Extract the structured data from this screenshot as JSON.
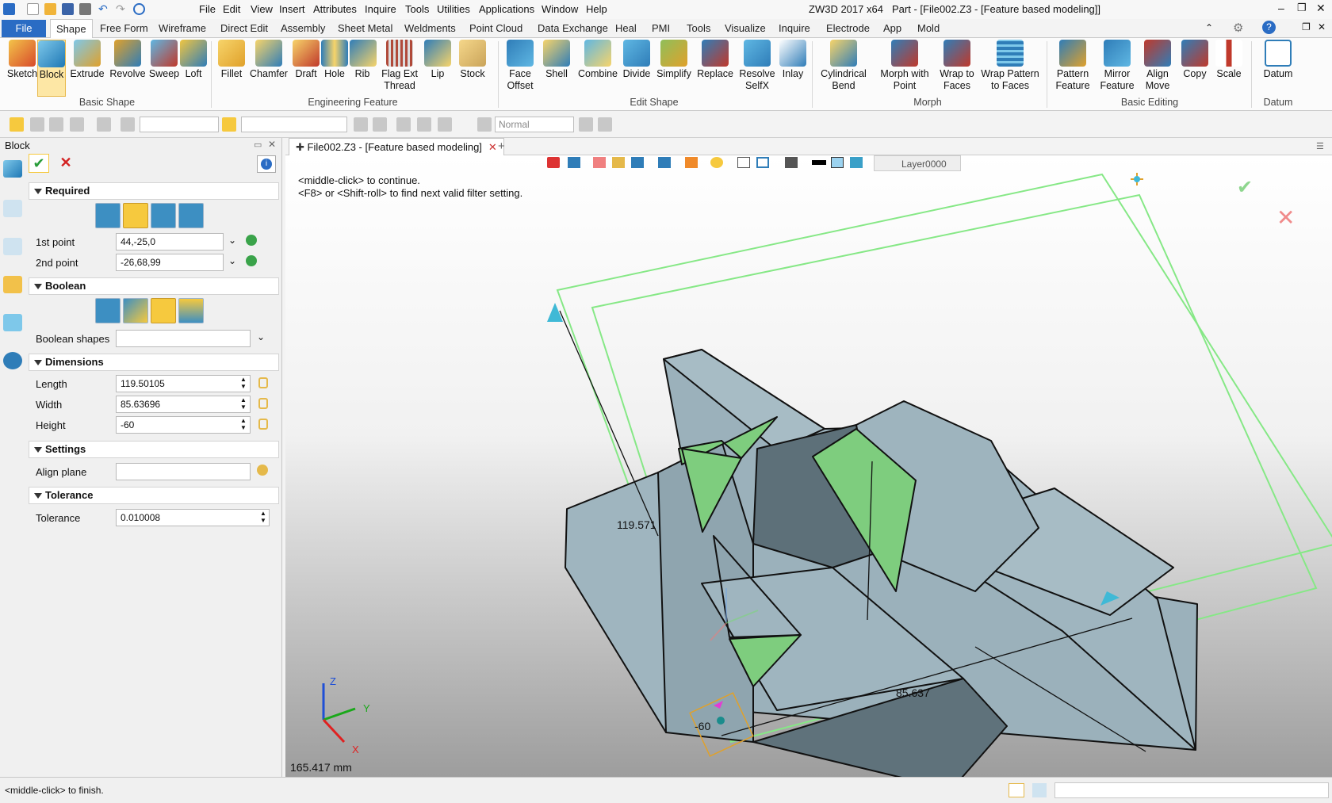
{
  "titlebar": {
    "menus": [
      "File",
      "Edit",
      "View",
      "Insert",
      "Attributes",
      "Inquire",
      "Tools",
      "Utilities",
      "Applications",
      "Window",
      "Help"
    ],
    "app_title": "ZW3D 2017  x64",
    "doc_title": "Part - [File002.Z3 - [Feature based modeling]]"
  },
  "ribbon_tabs": [
    "File",
    "Shape",
    "Free Form",
    "Wireframe",
    "Direct Edit",
    "Assembly",
    "Sheet Metal",
    "Weldments",
    "Point Cloud",
    "Data Exchange",
    "Heal",
    "PMI",
    "Tools",
    "Visualize",
    "Inquire",
    "Electrode",
    "App",
    "Mold"
  ],
  "ribbon": {
    "basic_shape": {
      "label": "Basic Shape",
      "buttons": [
        "Sketch",
        "Block",
        "Extrude",
        "Revolve",
        "Sweep",
        "Loft"
      ]
    },
    "engineering_feature": {
      "label": "Engineering Feature",
      "buttons": [
        "Fillet",
        "Chamfer",
        "Draft",
        "Hole",
        "Rib",
        "Flag Ext Thread",
        "Lip",
        "Stock"
      ]
    },
    "edit_shape": {
      "label": "Edit Shape",
      "buttons": [
        "Face Offset",
        "Shell",
        "Combine",
        "Divide",
        "Simplify",
        "Replace",
        "Resolve SelfX",
        "Inlay"
      ]
    },
    "morph": {
      "label": "Morph",
      "buttons": [
        "Cylindrical Bend",
        "Morph with Point",
        "Wrap to Faces",
        "Wrap Pattern to Faces"
      ]
    },
    "basic_editing": {
      "label": "Basic Editing",
      "buttons": [
        "Pattern Feature",
        "Mirror Feature",
        "Align Move",
        "Copy",
        "Scale"
      ]
    },
    "datum": {
      "label": "Datum",
      "buttons": [
        "Datum"
      ]
    }
  },
  "toolbar2": {
    "display_mode": "Normal"
  },
  "panel": {
    "title": "Block",
    "sections": {
      "required": "Required",
      "boolean": "Boolean",
      "dimensions": "Dimensions",
      "settings": "Settings",
      "tolerance": "Tolerance"
    },
    "fields": {
      "first_point_label": "1st point",
      "first_point": "44,-25,0",
      "second_point_label": "2nd point",
      "second_point": "-26,68,99",
      "boolean_shapes_label": "Boolean shapes",
      "length_label": "Length",
      "length": "119.50105",
      "width_label": "Width",
      "width": "85.63696",
      "height_label": "Height",
      "height": "-60",
      "align_plane_label": "Align plane",
      "tolerance_label": "Tolerance",
      "tolerance": "0.010008"
    }
  },
  "doc_tab": "File002.Z3 - [Feature based modeling]",
  "viewport": {
    "hint1": "<middle-click> to continue.",
    "hint2": "<F8> or <Shift-roll> to find next valid filter setting.",
    "layer": "Layer0000",
    "dim_length": "119.571",
    "dim_width": "85.637",
    "dim_height": "-60",
    "measure": "165.417 mm",
    "axis_x": "X",
    "axis_y": "Y",
    "axis_z": "Z"
  },
  "status": {
    "message": "<middle-click> to finish."
  }
}
